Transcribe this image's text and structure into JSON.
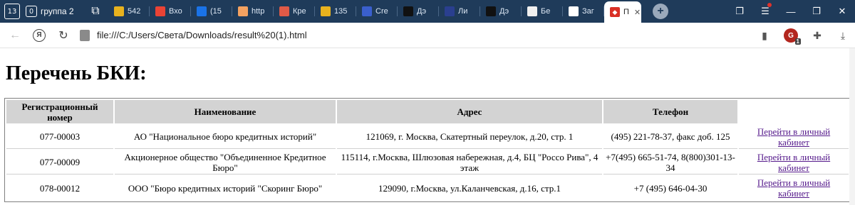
{
  "tabstrip": {
    "tab_count": "13",
    "group": {
      "count": "0",
      "label": "группа 2"
    },
    "tabs": [
      {
        "label": "542",
        "color": "#e8b21e",
        "icon": "mail-icon"
      },
      {
        "label": "Вхо",
        "color": "#ea4335",
        "icon": "gmail-icon"
      },
      {
        "label": "(15",
        "color": "#1a73e8",
        "icon": "mail-icon"
      },
      {
        "label": "http",
        "color": "#f4a261",
        "icon": "site-icon"
      },
      {
        "label": "Кре",
        "color": "#e05a47",
        "icon": "pdf-icon"
      },
      {
        "label": "135",
        "color": "#e8b21e",
        "icon": "mail-icon"
      },
      {
        "label": "Cre",
        "color": "#3a5fcd",
        "icon": "flag-icon"
      },
      {
        "label": "Дэ",
        "color": "#111111",
        "icon": "star-icon"
      },
      {
        "label": "Ли",
        "color": "#2a3f8f",
        "icon": "emblem-icon"
      },
      {
        "label": "Дэ",
        "color": "#111111",
        "icon": "star-icon"
      },
      {
        "label": "Бе",
        "color": "#f0f0f0",
        "icon": "doc-icon"
      },
      {
        "label": "Заг",
        "color": "#ffffff",
        "icon": "download-icon"
      }
    ],
    "active_tab": {
      "label": "П",
      "color": "#d93025",
      "icon": "html-file-icon"
    }
  },
  "toolbar": {
    "url": "file:///C:/Users/Света/Downloads/result%20(1).html",
    "extension_badge": "1",
    "ya_label": "Я"
  },
  "page": {
    "title": "Перечень БКИ:",
    "headers": [
      "Регистрационный номер",
      "Наименование",
      "Адрес",
      "Телефон",
      ""
    ],
    "rows": [
      {
        "reg": "077-00003",
        "name": "АО \"Национальное бюро кредитных историй\"",
        "address": "121069, г. Москва, Скатертный переулок, д.20, стр. 1",
        "phone": "(495) 221-78-37, факс доб. 125",
        "link": "Перейти в личный кабинет"
      },
      {
        "reg": "077-00009",
        "name": "Акционерное общество \"Объединенное Кредитное Бюро\"",
        "address": "115114, г.Москва, Шлюзовая набережная, д.4, БЦ \"Россо Рива\", 4 этаж",
        "phone": "+7(495) 665-51-74, 8(800)301-13-34",
        "link": "Перейти в личный кабинет"
      },
      {
        "reg": "078-00012",
        "name": "ООО \"Бюро кредитных историй \"Скоринг Бюро\"",
        "address": "129090, г.Москва, ул.Каланчевская, д.16, стр.1",
        "phone": "+7 (495) 646-04-30",
        "link": "Перейти в личный кабинет"
      }
    ]
  }
}
